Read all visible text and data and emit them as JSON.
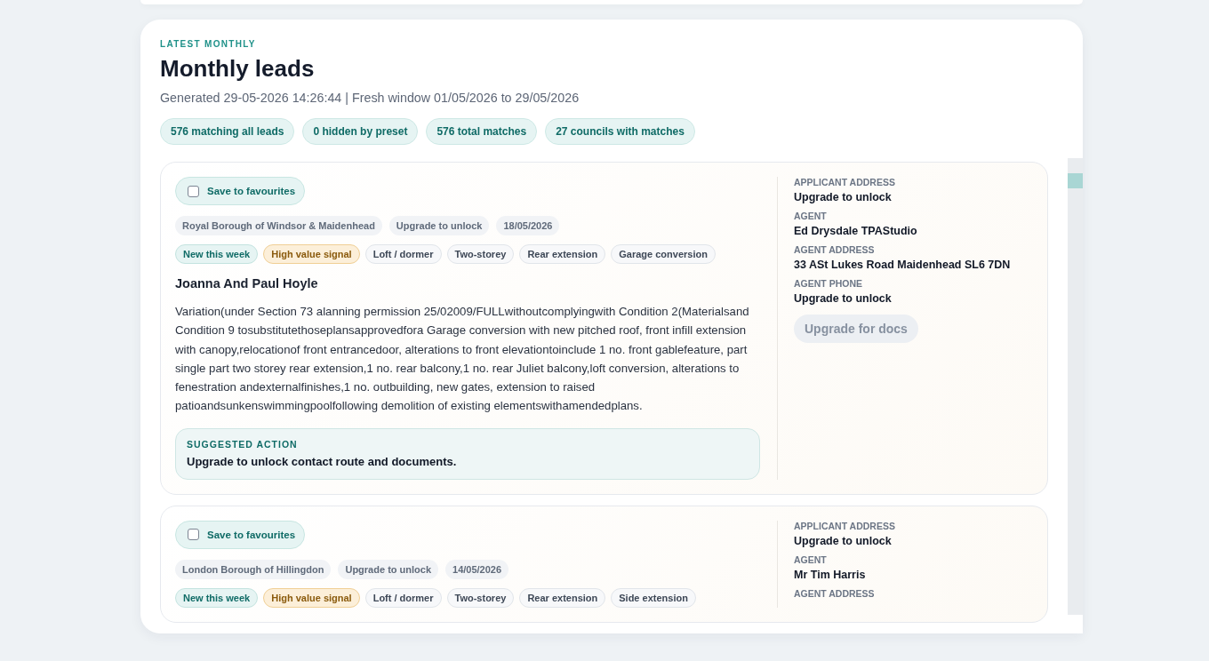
{
  "header": {
    "eyebrow": "LATEST MONTHLY",
    "title": "Monthly leads",
    "subtitle": "Generated 29-05-2026 14:26:44 | Fresh window 01/05/2026 to 29/05/2026"
  },
  "stats": [
    "576 matching all leads",
    "0 hidden by preset",
    "576 total matches",
    "27 councils with matches"
  ],
  "leads": [
    {
      "favourite": {
        "label": "Save to favourites",
        "checked": false
      },
      "meta": [
        "Royal Borough of Windsor & Maidenhead",
        "Upgrade to unlock",
        "18/05/2026"
      ],
      "tags": [
        {
          "label": "New this week",
          "kind": "new"
        },
        {
          "label": "High value signal",
          "kind": "value"
        },
        {
          "label": "Loft / dormer",
          "kind": "plain"
        },
        {
          "label": "Two-storey",
          "kind": "plain"
        },
        {
          "label": "Rear extension",
          "kind": "plain"
        },
        {
          "label": "Garage conversion",
          "kind": "plain"
        }
      ],
      "applicant": "Joanna And Paul Hoyle",
      "description": "Variation(under Section 73 alanning permission 25/02009/FULLwithoutcomplyingwith Condition 2(Materialsand Condition 9 tosubstitutethoseplansapprovedfora Garage conversion with new pitched roof, front infill extension with canopy,relocationof front entrancedoor, alterations to front elevationtoinclude 1 no. front gablefeature, part single part two storey rear extension,1 no. rear balcony,1 no. rear Juliet balcony,loft conversion, alterations to fenestration andexternalfinishes,1 no. outbuilding, new gates, extension to raised patioandsunkenswimmingpoolfollowing demolition of existing elementswithamendedplans.",
      "suggested_action": {
        "label": "SUGGESTED ACTION",
        "text": "Upgrade to unlock contact route and documents."
      },
      "details": [
        {
          "label": "APPLICANT ADDRESS",
          "value": "Upgrade to unlock"
        },
        {
          "label": "AGENT",
          "value": "Ed Drysdale TPAStudio"
        },
        {
          "label": "AGENT ADDRESS",
          "value": "33 ASt Lukes Road Maidenhead SL6 7DN"
        },
        {
          "label": "AGENT PHONE",
          "value": "Upgrade to unlock"
        }
      ],
      "docs_button": {
        "label": "Upgrade for docs",
        "disabled": true
      }
    },
    {
      "favourite": {
        "label": "Save to favourites",
        "checked": false
      },
      "meta": [
        "London Borough of Hillingdon",
        "Upgrade to unlock",
        "14/05/2026"
      ],
      "tags": [
        {
          "label": "New this week",
          "kind": "new"
        },
        {
          "label": "High value signal",
          "kind": "value"
        },
        {
          "label": "Loft / dormer",
          "kind": "plain"
        },
        {
          "label": "Two-storey",
          "kind": "plain"
        },
        {
          "label": "Rear extension",
          "kind": "plain"
        },
        {
          "label": "Side extension",
          "kind": "plain"
        }
      ],
      "details": [
        {
          "label": "APPLICANT ADDRESS",
          "value": "Upgrade to unlock"
        },
        {
          "label": "AGENT",
          "value": "Mr Tim Harris"
        },
        {
          "label": "AGENT ADDRESS"
        }
      ]
    }
  ]
}
